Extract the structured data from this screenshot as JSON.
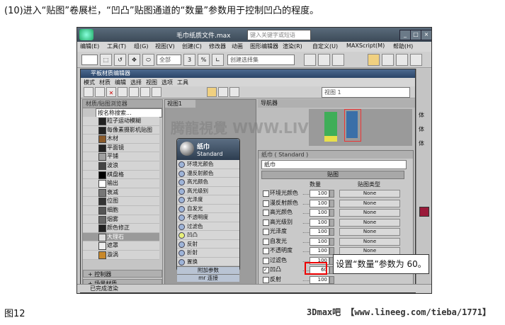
{
  "caption_top": "(10)进入“贴图”卷展栏，“凹凸”贴图通道的“数量”参数用于控制凹凸的程度。",
  "caption_bottom": "图12",
  "footer_watermark": "3Dmax吧 【www.lineeg.com/tieba/1771】",
  "window": {
    "title": "毛巾纸质文件.max",
    "search_placeholder": "键入关键字或短语",
    "menu": [
      "编辑(E)",
      "工具(T)",
      "组(G)",
      "视图(V)",
      "创建(C)",
      "修改器",
      "动画",
      "图形编辑器",
      "渲染(R)",
      "自定义(U)",
      "MAXScript(M)",
      "帮助(H)"
    ],
    "selection_set_placeholder": "创建选择集",
    "toolbar_glyphs": [
      "⬚",
      "↺",
      "✥",
      "⬭",
      "3",
      "%",
      "∟"
    ],
    "all_dropdown": "全部",
    "status_text": "已完成渲染",
    "right_panel_text": [
      "体",
      "体",
      "体"
    ]
  },
  "slate": {
    "title": "平板材质编辑器",
    "menu": [
      "模式",
      "材质",
      "编辑",
      "选择",
      "视图",
      "选项",
      "工具"
    ],
    "browser_title": "材质/贴图浏览器",
    "search_placeholder": "按名称搜索...",
    "map_items": [
      {
        "label": "粒子运动模糊",
        "color": "#222222"
      },
      {
        "label": "每像素摄影机贴图",
        "color": "#222222"
      },
      {
        "label": "木材",
        "color": "#8a5a2a"
      },
      {
        "label": "平面镜",
        "color": "#222222"
      },
      {
        "label": "平铺",
        "color": "#a0a0a0"
      },
      {
        "label": "波浪",
        "color": "#444444"
      },
      {
        "label": "棋盘格",
        "color": "#000000"
      },
      {
        "label": "输出",
        "color": "#ffffff"
      },
      {
        "label": "衰减",
        "color": "#777777"
      },
      {
        "label": "位图",
        "color": "#333333"
      },
      {
        "label": "细胞",
        "color": "#555555"
      },
      {
        "label": "烟雾",
        "color": "#666666"
      },
      {
        "label": "颜色修正",
        "color": "#222222"
      },
      {
        "label": "大理石",
        "color": "#dddddd"
      },
      {
        "label": "遮罩",
        "color": "#eeeeee"
      },
      {
        "label": "漩涡",
        "color": "#c8882a"
      }
    ],
    "selected_index": 13,
    "rollouts": [
      "+ 控制器",
      "+ 场景材质"
    ],
    "view_tab": "视图1",
    "navigator_title": "导航器",
    "view_select": "视图 1",
    "node": {
      "title": "纸巾",
      "subtitle": "Standard",
      "slots": [
        "环境光颜色",
        "漫反射颜色",
        "高光颜色",
        "高光级别",
        "光泽度",
        "自发光",
        "不透明度",
        "过滤色",
        "凹凸",
        "反射",
        "折射",
        "置换"
      ],
      "highlight_slot": 8,
      "footer1": "附加参数",
      "footer2": "mr 连接"
    },
    "param_head": "纸巾 ( Standard )",
    "param_name": "纸巾",
    "maps_rollout": "贴图",
    "col_amount": "数量",
    "col_map_type": "贴图类型",
    "param_rows": [
      {
        "label": "环境光颜色",
        "amount": "100",
        "map": "None",
        "checked": false
      },
      {
        "label": "漫反射颜色",
        "amount": "100",
        "map": "None",
        "checked": false
      },
      {
        "label": "高光颜色",
        "amount": "100",
        "map": "None",
        "checked": false
      },
      {
        "label": "高光级别",
        "amount": "100",
        "map": "None",
        "checked": false
      },
      {
        "label": "光泽度",
        "amount": "100",
        "map": "None",
        "checked": false
      },
      {
        "label": "自发光",
        "amount": "100",
        "map": "None",
        "checked": false
      },
      {
        "label": "不透明度",
        "amount": "100",
        "map": "None",
        "checked": false
      },
      {
        "label": "过滤色",
        "amount": "100",
        "map": "None",
        "checked": false
      },
      {
        "label": "凹凸",
        "amount": "60",
        "map": "",
        "checked": true
      },
      {
        "label": "反射",
        "amount": "100",
        "map": "",
        "checked": false
      }
    ]
  },
  "callout": "设置“数量”参数为 60。",
  "watermark": "腾龍視覺 WWW.LIVI.NET"
}
